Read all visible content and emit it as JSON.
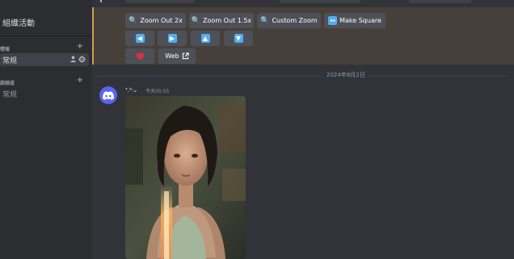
{
  "sidebar": {
    "server_title": "組織活動",
    "categories": [
      {
        "label": "情報",
        "channel": "常规"
      },
      {
        "label": "語頻道",
        "channel": "常规"
      }
    ]
  },
  "toolbar": {
    "buttons": [
      {
        "label": "Zoom Out 2x",
        "icon": "magnifier-icon"
      },
      {
        "label": "Zoom Out 1.5x",
        "icon": "magnifier-icon"
      },
      {
        "label": "Custom Zoom",
        "icon": "magnifier-icon"
      },
      {
        "label": "Make Square",
        "icon": "left-right-arrow-icon"
      }
    ],
    "arrows": [
      {
        "icon": "arrow-left-icon",
        "glyph": "◀"
      },
      {
        "icon": "arrow-right-icon",
        "glyph": "▶"
      },
      {
        "icon": "arrow-up-icon",
        "glyph": "▲"
      },
      {
        "icon": "arrow-down-icon",
        "glyph": "▼"
      }
    ],
    "heart_icon": "heart-icon",
    "web_label": "Web",
    "external_icon": "external-link-icon"
  },
  "chat": {
    "date_divider": "2024年8月2日",
    "message": {
      "author": "ᵀ.ˡᵒ.ᵥ",
      "timestamp": "今天05:55"
    }
  },
  "colors": {
    "background": "#313338",
    "sidebar": "#2b2d31",
    "highlight": "#47403a",
    "accent": "#c9a04f",
    "button": "#4e5058",
    "brand": "#5865f2"
  }
}
